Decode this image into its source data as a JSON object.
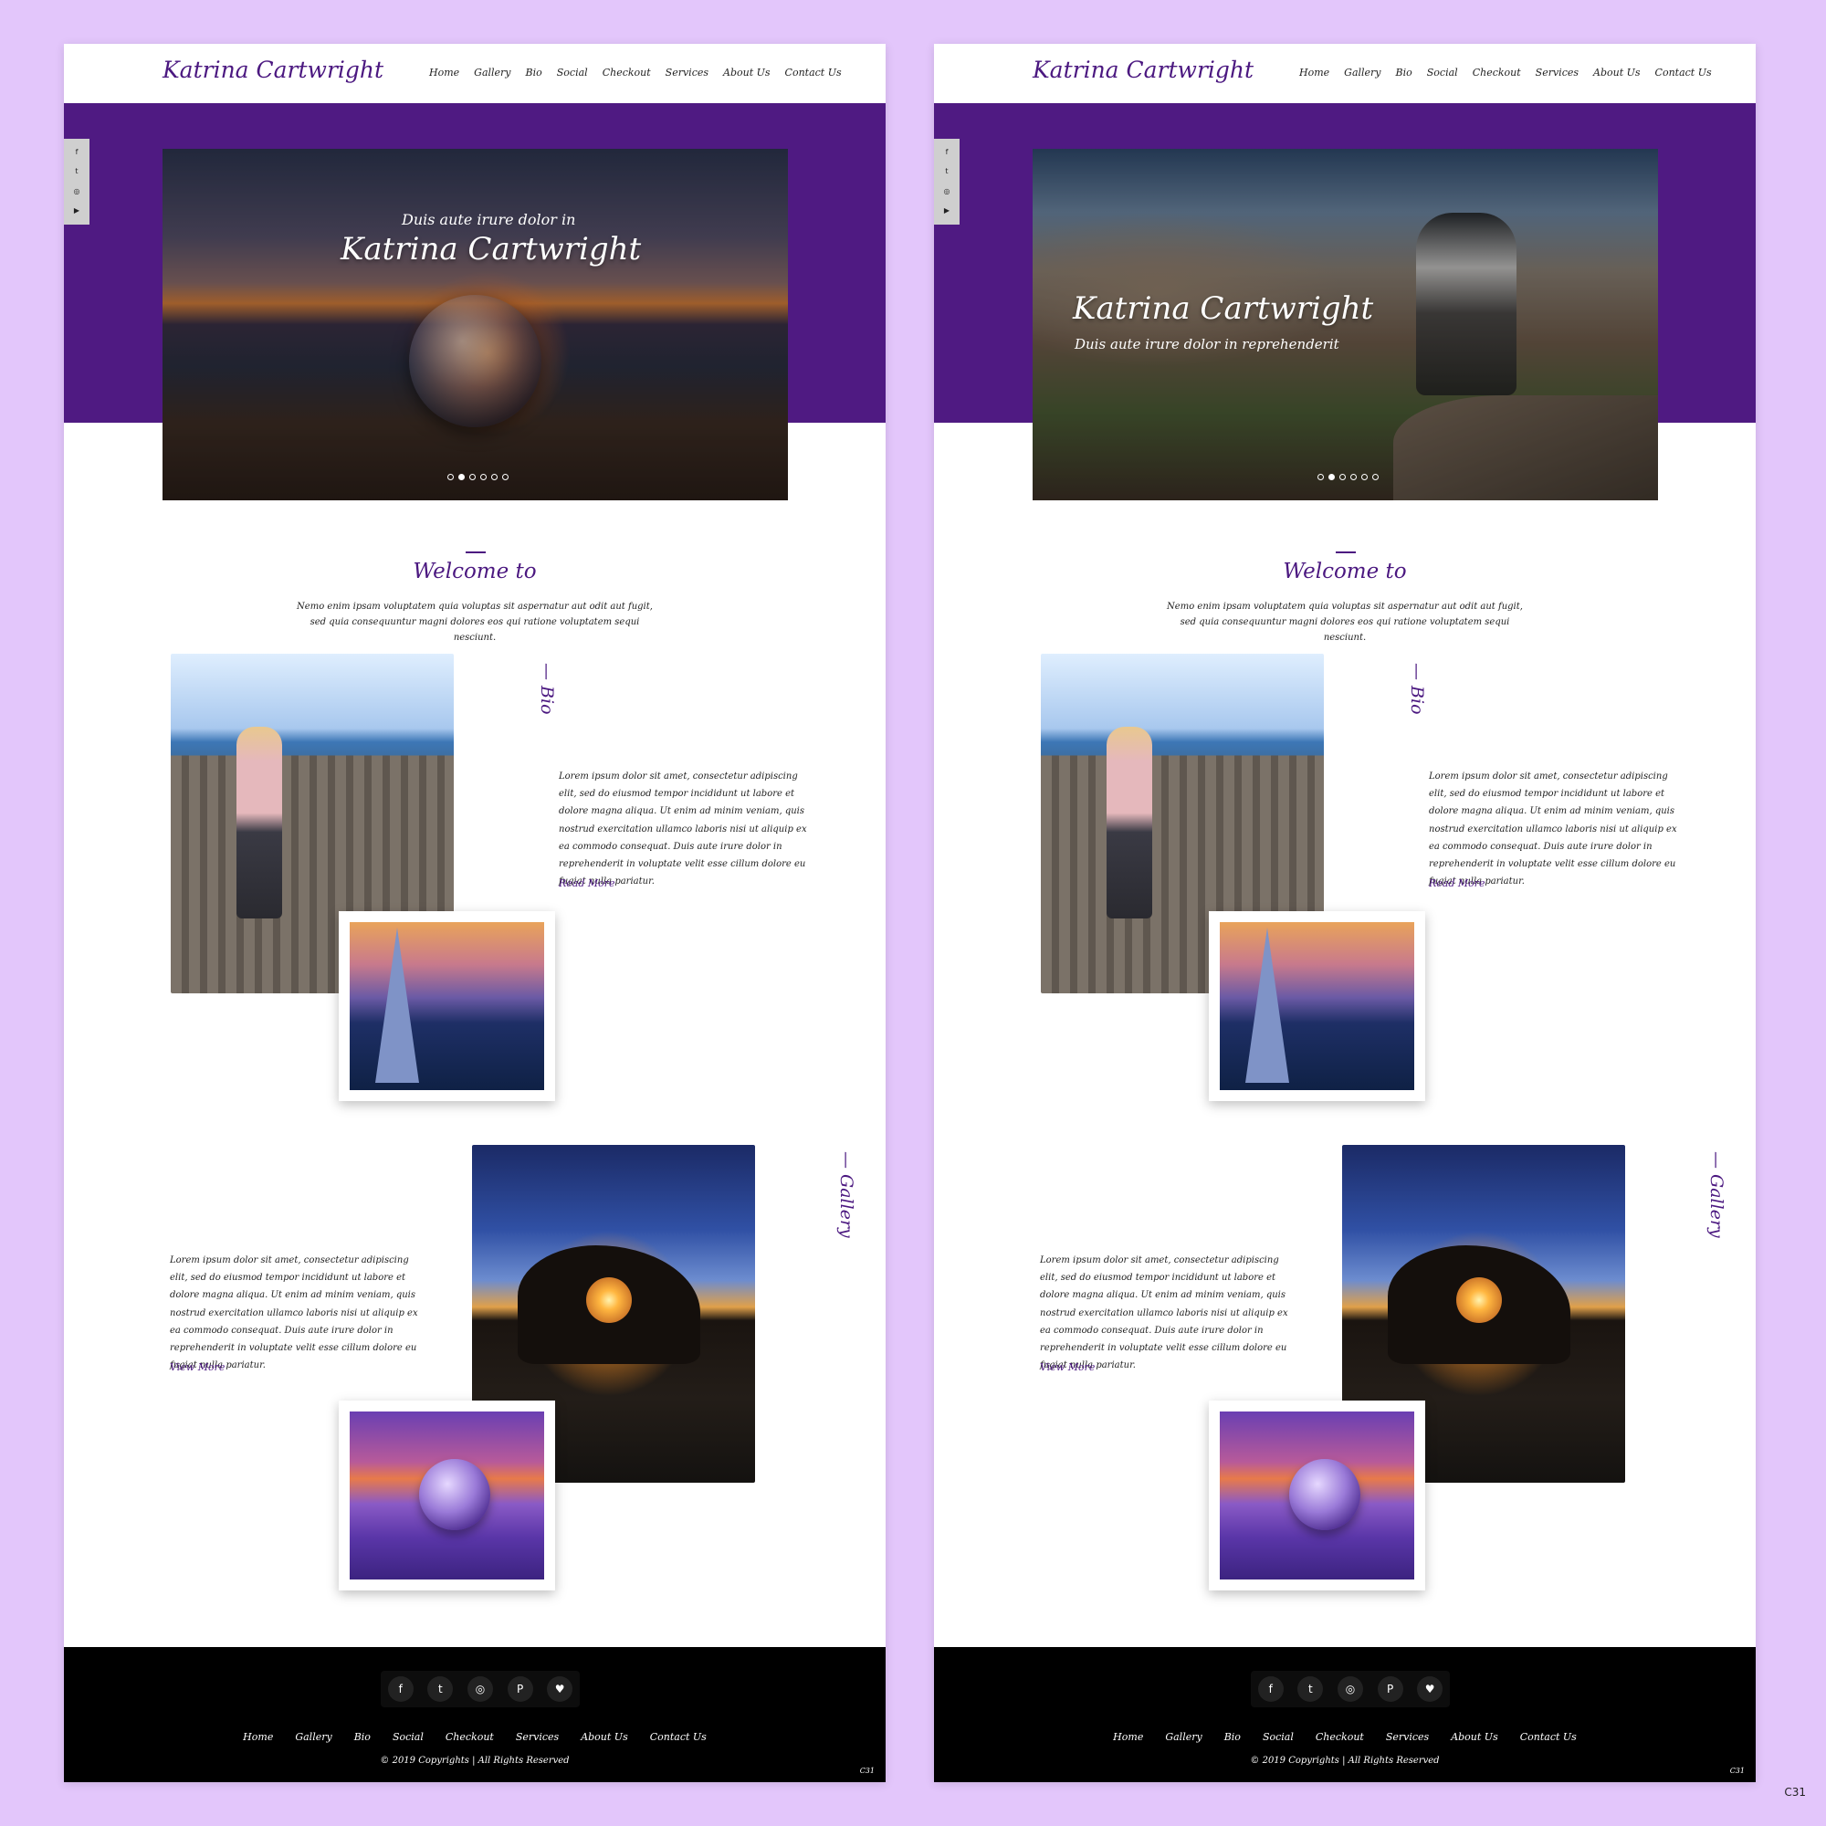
{
  "brand": "Katrina Cartwright",
  "nav": [
    "Home",
    "Gallery",
    "Bio",
    "Social",
    "Checkout",
    "Services",
    "About Us",
    "Contact Us"
  ],
  "social_rail": [
    {
      "icon": "facebook-icon",
      "glyph": "f"
    },
    {
      "icon": "twitter-icon",
      "glyph": "t"
    },
    {
      "icon": "instagram-icon",
      "glyph": "◎"
    },
    {
      "icon": "youtube-icon",
      "glyph": "▶"
    }
  ],
  "hero_a": {
    "pretitle": "Duis aute irure dolor in",
    "title": "Katrina Cartwright"
  },
  "hero_b": {
    "title": "Katrina Cartwright",
    "subtitle": "Duis aute irure dolor in reprehenderit"
  },
  "hero_active_dot": 1,
  "welcome": {
    "title": "Welcome to",
    "text": "Nemo enim ipsam voluptatem quia voluptas sit aspernatur aut odit aut fugit, sed quia consequuntur magni dolores eos qui ratione voluptatem sequi nesciunt."
  },
  "bio": {
    "label": "— Bio",
    "text": "Lorem ipsum dolor sit amet, consectetur adipiscing elit, sed do eiusmod tempor incididunt ut labore et dolore magna aliqua. Ut enim ad minim veniam, quis nostrud exercitation ullamco laboris nisi ut aliquip ex ea commodo consequat. Duis aute irure dolor in reprehenderit in voluptate velit esse cillum dolore eu fugiat nulla pariatur.",
    "link": "Read More"
  },
  "gallery": {
    "label": "— Gallery",
    "text": "Lorem ipsum dolor sit amet, consectetur adipiscing elit, sed do eiusmod tempor incididunt ut labore et dolore magna aliqua. Ut enim ad minim veniam, quis nostrud exercitation ullamco laboris nisi ut aliquip ex ea commodo consequat. Duis aute irure dolor in reprehenderit in voluptate velit esse cillum dolore eu fugiat nulla pariatur.",
    "link": "View More"
  },
  "footer": {
    "social": [
      {
        "icon": "facebook-icon",
        "glyph": "f"
      },
      {
        "icon": "twitter-icon",
        "glyph": "t"
      },
      {
        "icon": "instagram-icon",
        "glyph": "◎"
      },
      {
        "icon": "pinterest-icon",
        "glyph": "P"
      },
      {
        "icon": "heart-icon",
        "glyph": "♥"
      }
    ],
    "copyright": "© 2019 Copyrights | All Rights Reserved",
    "code": "C31"
  },
  "corner_code": "C31",
  "colors": {
    "accent": "#4f1a82",
    "text_accent": "#4b1880",
    "background": "#e3c6fb",
    "footer": "#000000"
  }
}
